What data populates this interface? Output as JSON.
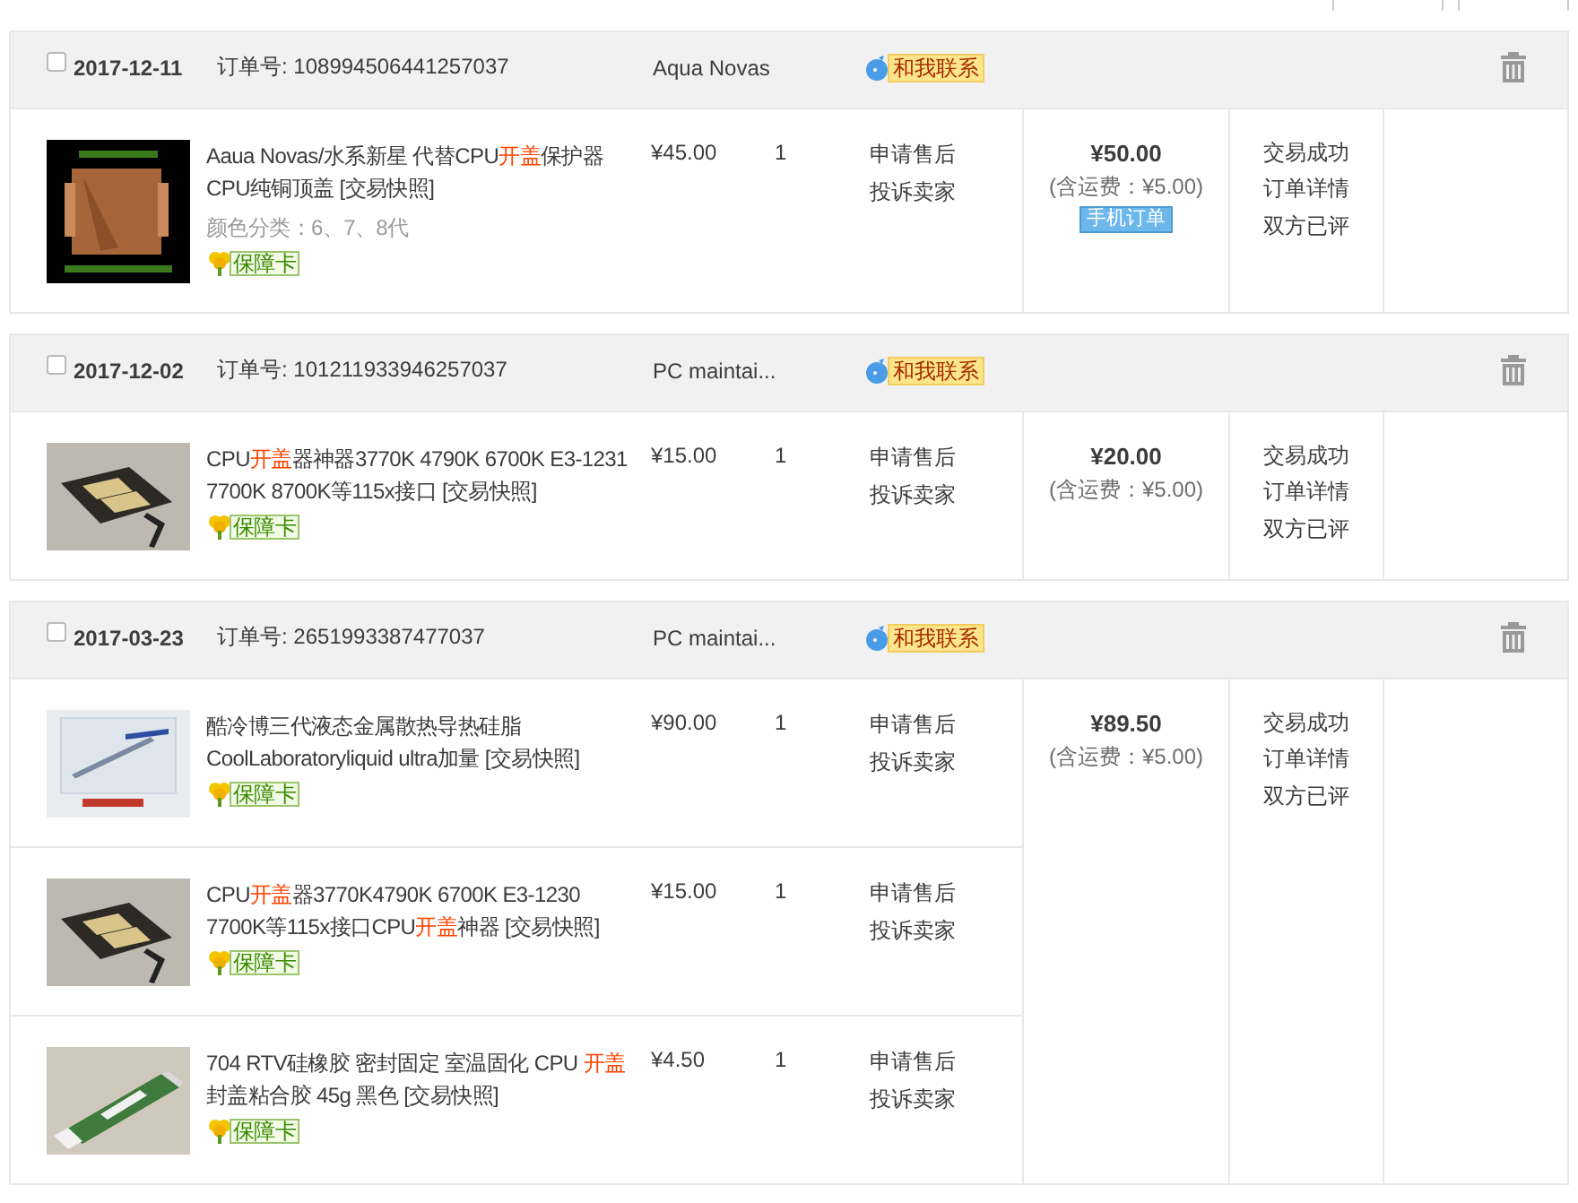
{
  "orders": [
    {
      "checked": false,
      "date": "2017-12-11",
      "order_label": "订单号:",
      "order_no": "108994506441257037",
      "shop": "Aqua Novas",
      "contact": "和我联系",
      "total": "¥50.00",
      "shipping": "(含运费：¥5.00)",
      "mobile_tag": "手机订单",
      "status": [
        "交易成功",
        "订单详情",
        "双方已评"
      ],
      "items": [
        {
          "title": [
            {
              "text": "Aaua Novas/水系新星 代替CPU",
              "red": false
            },
            {
              "text": "开盖",
              "red": true
            },
            {
              "text": "保护器 CPU纯铜顶盖 [交易快照]",
              "red": false
            }
          ],
          "variant": "颜色分类：6、7、8代",
          "badge": "保障卡",
          "price": "¥45.00",
          "qty": "1",
          "actions": [
            "申请售后",
            "投诉卖家"
          ]
        }
      ]
    },
    {
      "checked": false,
      "date": "2017-12-02",
      "order_label": "订单号:",
      "order_no": "101211933946257037",
      "shop": "PC maintai...",
      "contact": "和我联系",
      "total": "¥20.00",
      "shipping": "(含运费：¥5.00)",
      "status": [
        "交易成功",
        "订单详情",
        "双方已评"
      ],
      "items": [
        {
          "title": [
            {
              "text": "CPU",
              "red": false
            },
            {
              "text": "开盖",
              "red": true
            },
            {
              "text": "器神器3770K 4790K 6700K E3-1231 7700K 8700K等115x接口 [交易快照]",
              "red": false
            }
          ],
          "badge": "保障卡",
          "price": "¥15.00",
          "qty": "1",
          "actions": [
            "申请售后",
            "投诉卖家"
          ]
        }
      ]
    },
    {
      "checked": false,
      "date": "2017-03-23",
      "order_label": "订单号:",
      "order_no": "2651993387477037",
      "shop": "PC maintai...",
      "contact": "和我联系",
      "total": "¥89.50",
      "shipping": "(含运费：¥5.00)",
      "status": [
        "交易成功",
        "订单详情",
        "双方已评"
      ],
      "items": [
        {
          "title": [
            {
              "text": "酷冷博三代液态金属散热导热硅脂CoolLaboratoryliquid ultra加量 [交易快照]",
              "red": false
            }
          ],
          "badge": "保障卡",
          "price": "¥90.00",
          "qty": "1",
          "actions": [
            "申请售后",
            "投诉卖家"
          ]
        },
        {
          "title": [
            {
              "text": "CPU",
              "red": false
            },
            {
              "text": "开盖",
              "red": true
            },
            {
              "text": "器3770K4790K 6700K E3-1230 7700K等115x接口CPU",
              "red": false
            },
            {
              "text": "开盖",
              "red": true
            },
            {
              "text": "神器 [交易快照]",
              "red": false
            }
          ],
          "badge": "保障卡",
          "price": "¥15.00",
          "qty": "1",
          "actions": [
            "申请售后",
            "投诉卖家"
          ]
        },
        {
          "title": [
            {
              "text": "704 RTV硅橡胶 密封固定 室温固化 CPU ",
              "red": false
            },
            {
              "text": "开盖",
              "red": true
            },
            {
              "text": "封盖粘合胶 45g 黑色 [交易快照]",
              "red": false
            }
          ],
          "badge": "保障卡",
          "price": "¥4.50",
          "qty": "1",
          "actions": [
            "申请售后",
            "投诉卖家"
          ]
        }
      ]
    }
  ]
}
